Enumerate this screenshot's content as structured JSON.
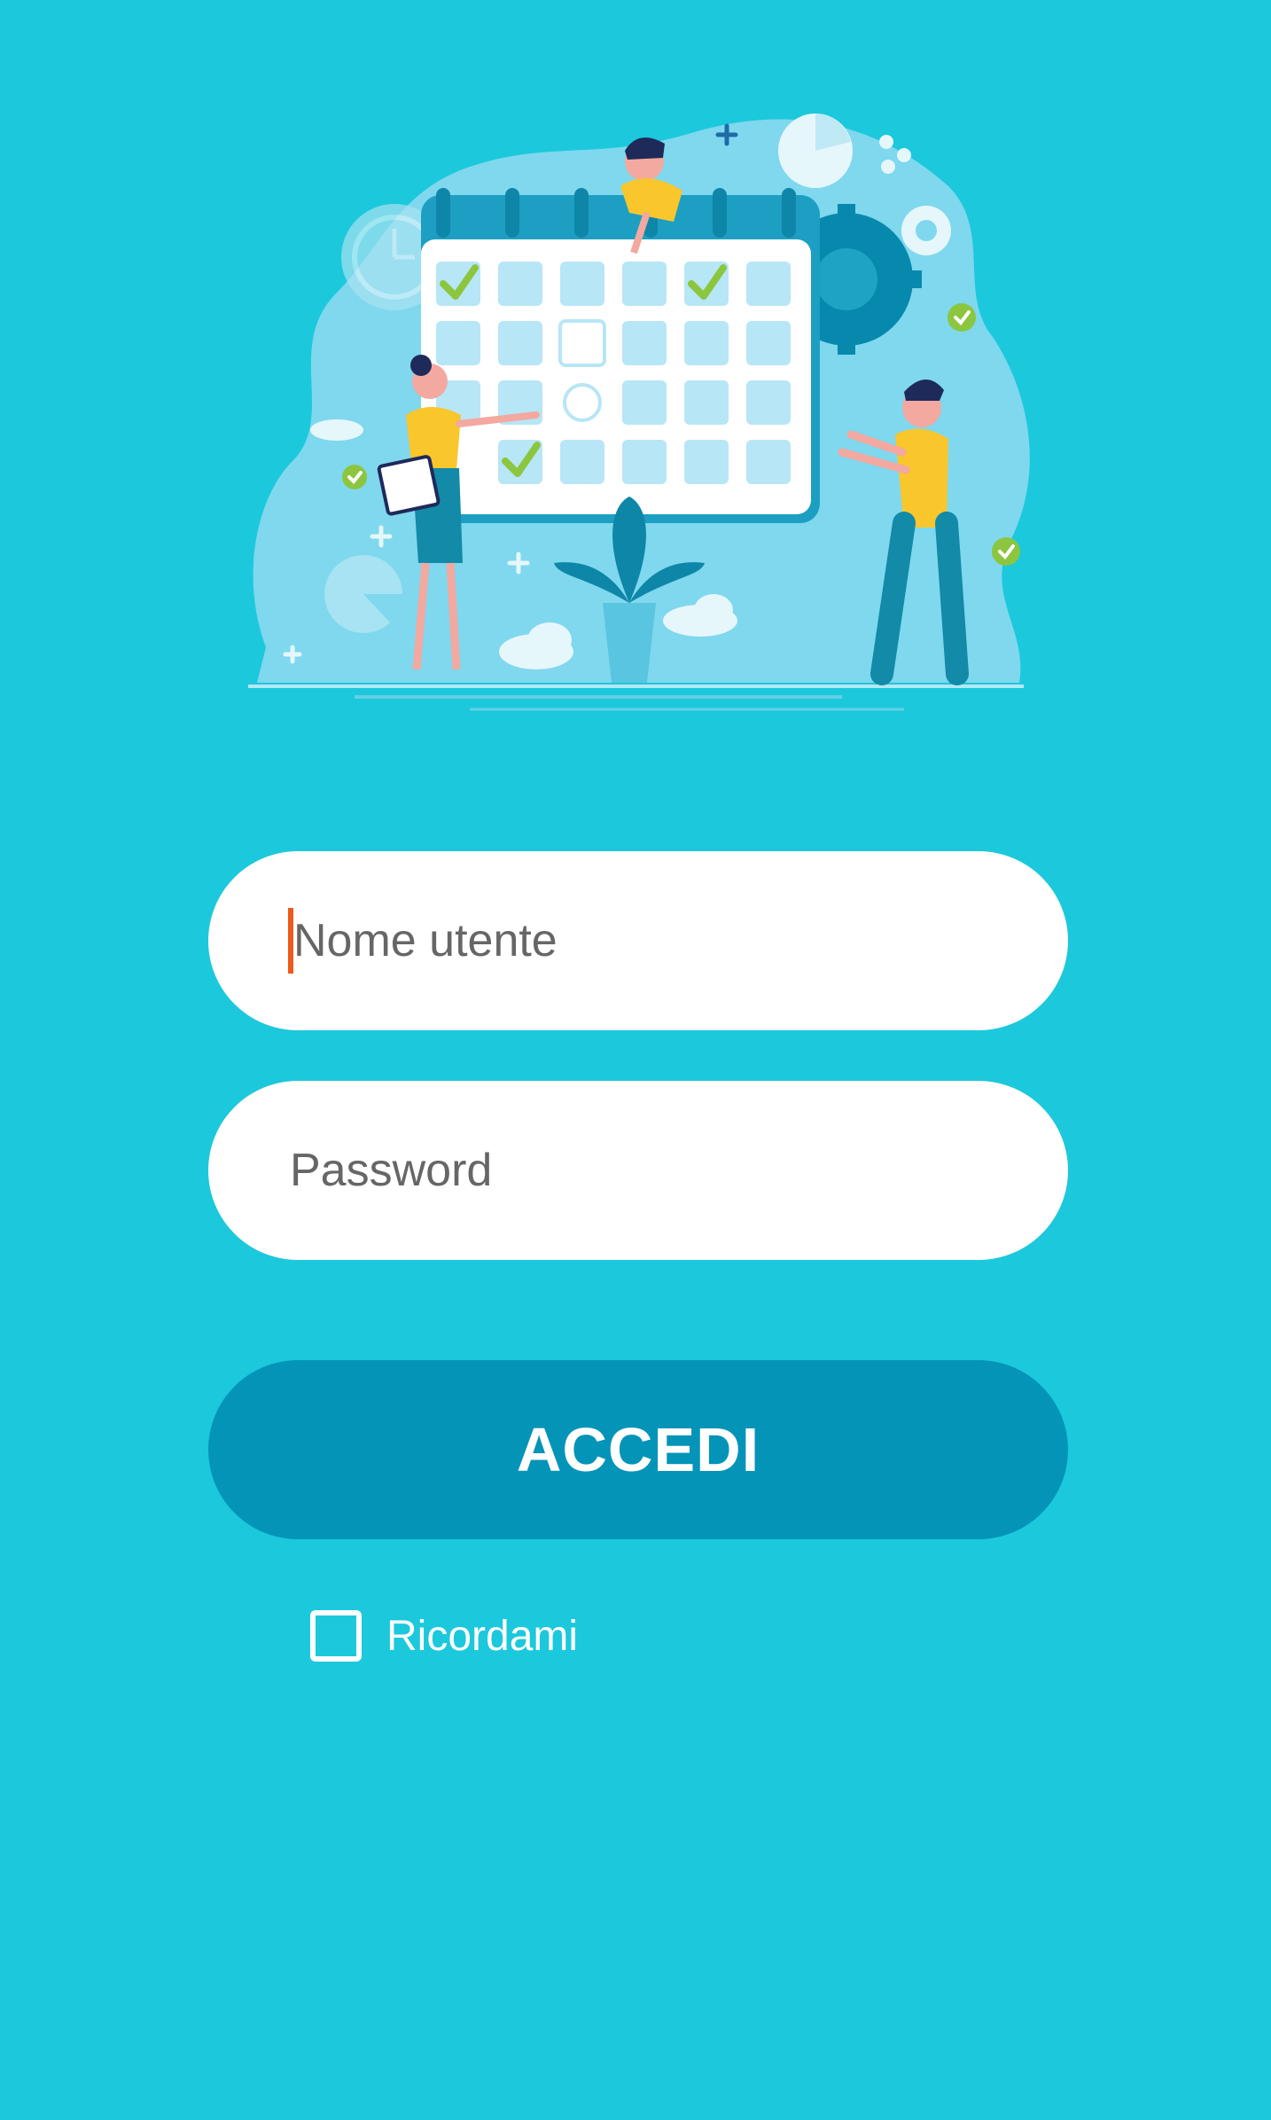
{
  "login": {
    "username_placeholder": "Nome utente",
    "password_placeholder": "Password",
    "submit_label": "ACCEDI",
    "remember_label": "Ricordami",
    "remember_checked": false
  },
  "illustration": {
    "name": "calendar-scheduling-illustration"
  },
  "colors": {
    "background": "#1cc8dc",
    "button": "#0394b8",
    "field": "#ffffff",
    "caret": "#ee5a1c",
    "accent_yellow": "#f9c62b",
    "check_green": "#8cc63f"
  }
}
